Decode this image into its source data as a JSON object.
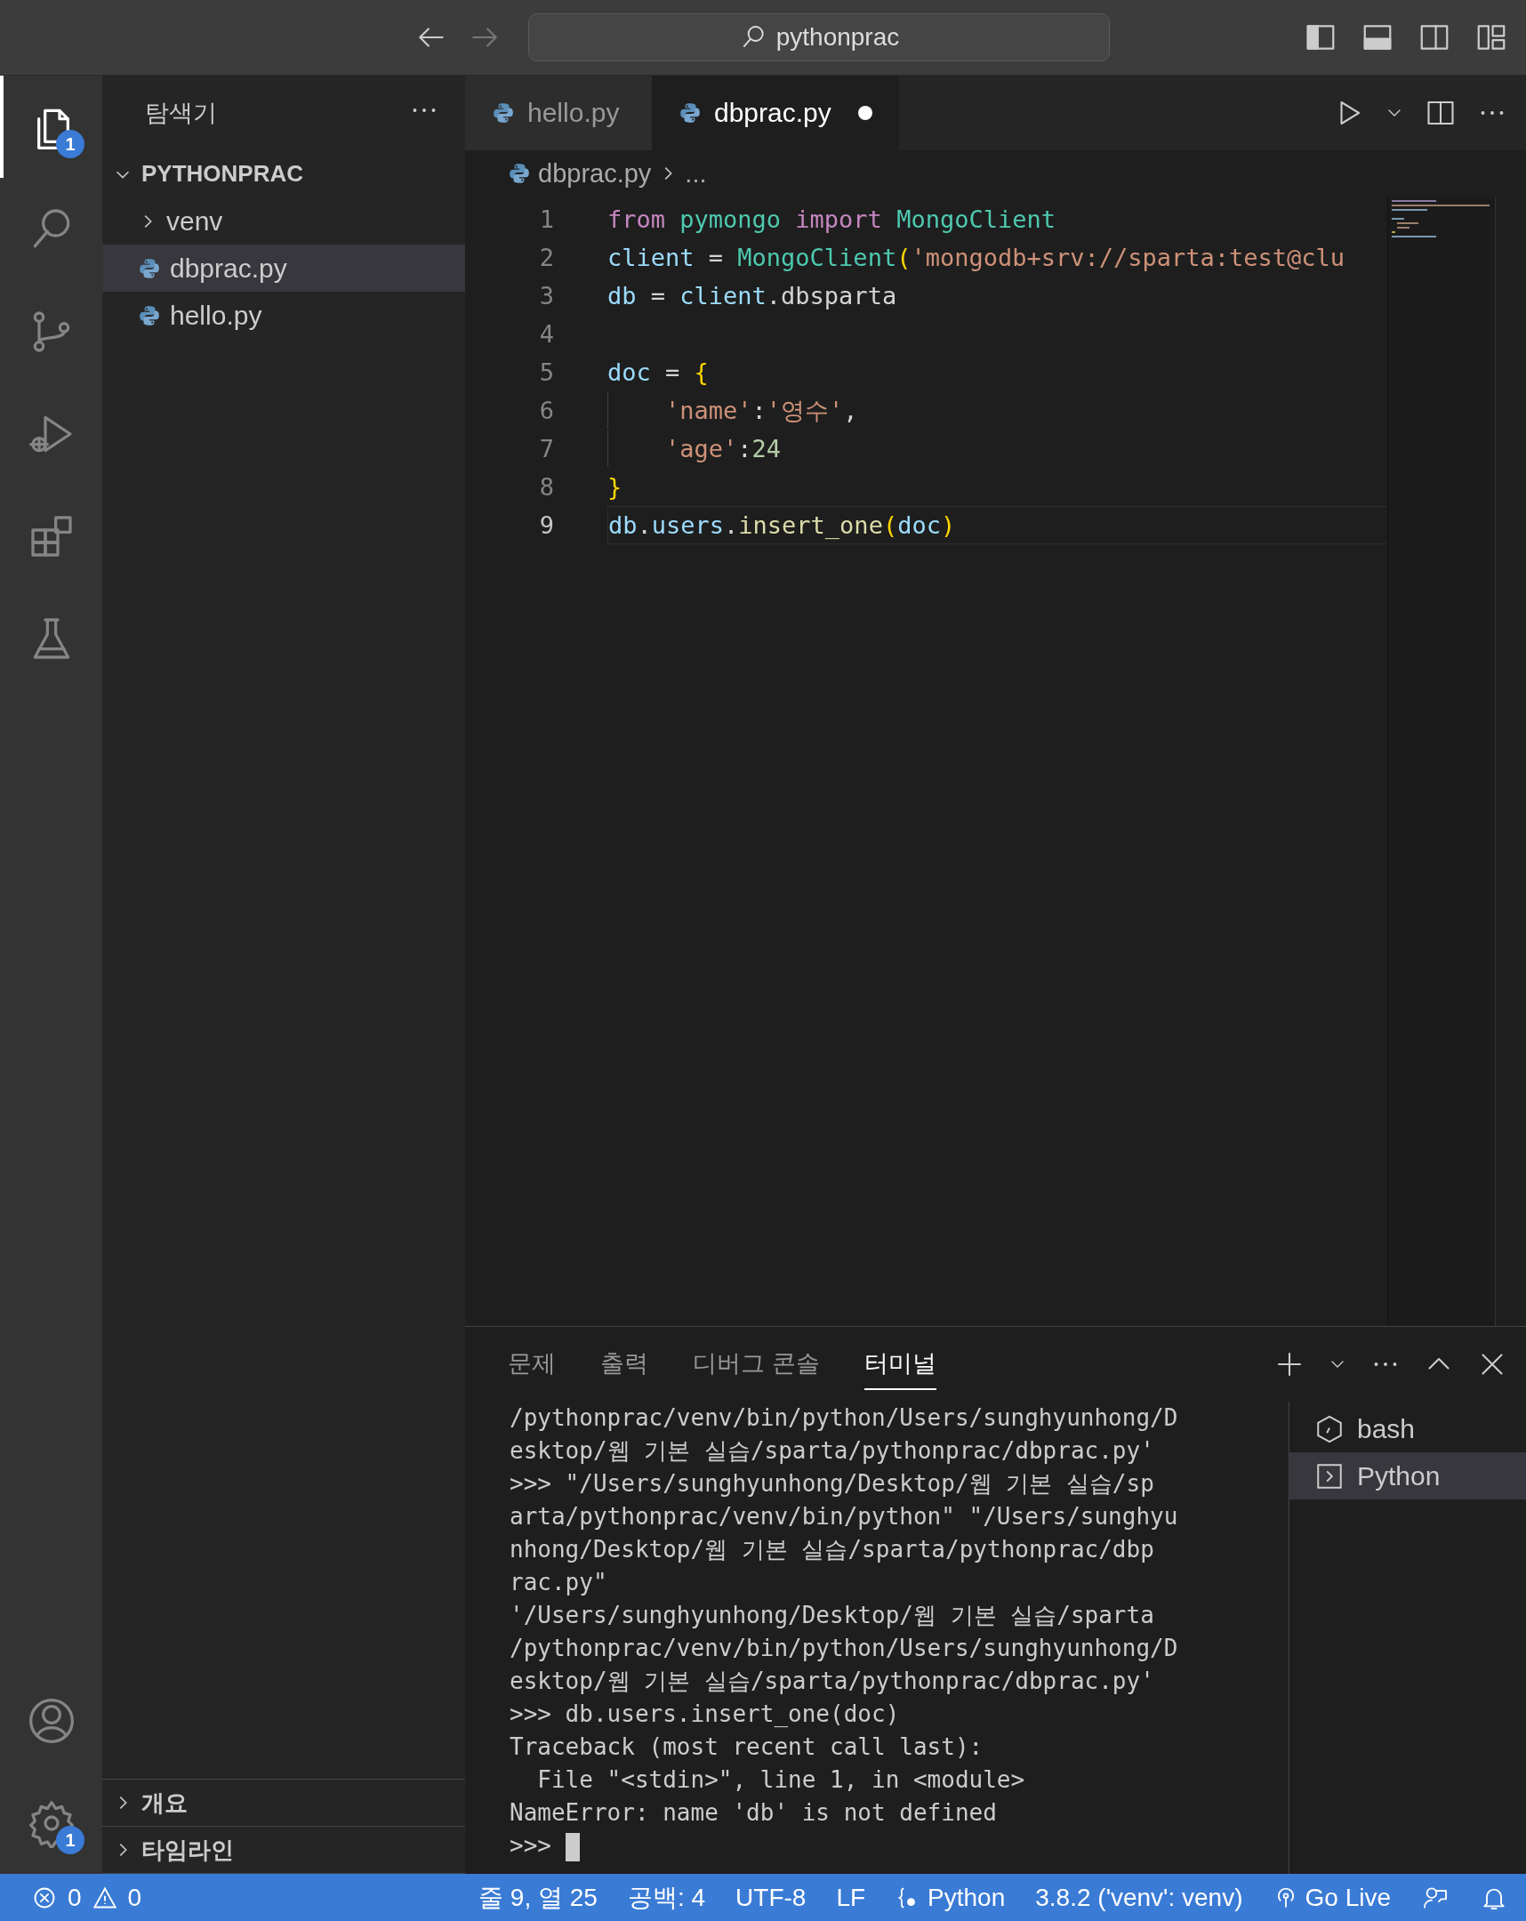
{
  "title_bar": {
    "search": "pythonprac"
  },
  "activity_bar": [
    {
      "kind": "explorer",
      "selected": true,
      "badge": "1"
    },
    {
      "kind": "search",
      "selected": false
    },
    {
      "kind": "source-control",
      "selected": false
    },
    {
      "kind": "run-debug",
      "selected": false
    },
    {
      "kind": "extensions",
      "selected": false
    },
    {
      "kind": "testing",
      "selected": false
    }
  ],
  "activity_bar_bottom": [
    {
      "kind": "account"
    },
    {
      "kind": "settings",
      "badge": "1"
    }
  ],
  "sidebar": {
    "title": "탐색기",
    "folder": {
      "name": "PYTHONPRAC",
      "expanded": true,
      "children": [
        {
          "name": "venv",
          "kind": "folder",
          "expanded": false,
          "selected": false
        },
        {
          "name": "dbprac.py",
          "kind": "python",
          "selected": true
        },
        {
          "name": "hello.py",
          "kind": "python",
          "selected": false
        }
      ]
    },
    "sections": [
      {
        "label": "개요",
        "expanded": false
      },
      {
        "label": "타임라인",
        "expanded": false
      }
    ]
  },
  "tabs": [
    {
      "label": "hello.py",
      "selected": false,
      "modified": false
    },
    {
      "label": "dbprac.py",
      "selected": true,
      "modified": true
    }
  ],
  "breadcrumb": [
    "dbprac.py",
    "..."
  ],
  "editor": {
    "lines": [
      {
        "number": "1",
        "current": false,
        "tokens": [
          {
            "t": "from ",
            "color": "#c586c0"
          },
          {
            "t": "pymongo ",
            "color": "#4ec9b0"
          },
          {
            "t": "import ",
            "color": "#c586c0"
          },
          {
            "t": "MongoClient",
            "color": "#4ec9b0"
          }
        ]
      },
      {
        "number": "2",
        "current": false,
        "tokens": [
          {
            "t": "client",
            "color": "#9cdcfe"
          },
          {
            "t": " = ",
            "color": "#d4d4d4"
          },
          {
            "t": "MongoClient",
            "color": "#4ec9b0"
          },
          {
            "t": "(",
            "color": "#ffd700"
          },
          {
            "t": "'mongodb+srv://sparta:test@clu",
            "color": "#ce9178"
          }
        ]
      },
      {
        "number": "3",
        "current": false,
        "tokens": [
          {
            "t": "db",
            "color": "#9cdcfe"
          },
          {
            "t": " = ",
            "color": "#d4d4d4"
          },
          {
            "t": "client",
            "color": "#9cdcfe"
          },
          {
            "t": ".dbsparta",
            "color": "#d4d4d4"
          }
        ]
      },
      {
        "number": "4",
        "current": false
      },
      {
        "number": "5",
        "current": false,
        "tokens": [
          {
            "t": "doc",
            "color": "#9cdcfe"
          },
          {
            "t": " = ",
            "color": "#d4d4d4"
          },
          {
            "t": "{",
            "color": "#ffd700"
          }
        ]
      },
      {
        "number": "6",
        "current": false,
        "indented": true,
        "tokens": [
          {
            "t": "'name'",
            "color": "#ce9178"
          },
          {
            "t": ":",
            "color": "#d4d4d4"
          },
          {
            "t": "'영수'",
            "color": "#ce9178"
          },
          {
            "t": ",",
            "color": "#d4d4d4"
          }
        ]
      },
      {
        "number": "7",
        "current": false,
        "indented": true,
        "tokens": [
          {
            "t": "'age'",
            "color": "#ce9178"
          },
          {
            "t": ":",
            "color": "#d4d4d4"
          },
          {
            "t": "24",
            "color": "#b5cea8"
          }
        ]
      },
      {
        "number": "8",
        "current": false,
        "tokens": [
          {
            "t": "}",
            "color": "#ffd700"
          }
        ]
      },
      {
        "number": "9",
        "current": true,
        "tokens": [
          {
            "t": "db",
            "color": "#9cdcfe"
          },
          {
            "t": ".",
            "color": "#d4d4d4"
          },
          {
            "t": "users",
            "color": "#9cdcfe"
          },
          {
            "t": ".",
            "color": "#d4d4d4"
          },
          {
            "t": "insert_one",
            "color": "#dcdcaa"
          },
          {
            "t": "(",
            "color": "#ffd700"
          },
          {
            "t": "doc",
            "color": "#9cdcfe"
          },
          {
            "t": ")",
            "color": "#ffd700"
          }
        ]
      }
    ]
  },
  "panel": {
    "tabs": [
      {
        "label": "문제",
        "selected": false
      },
      {
        "label": "출력",
        "selected": false
      },
      {
        "label": "디버그 콘솔",
        "selected": false
      },
      {
        "label": "터미널",
        "selected": true
      }
    ],
    "terminal_lines": [
      "/pythonprac/venv/bin/python/Users/sunghyunhong/D",
      "esktop/웹 기본 실습/sparta/pythonprac/dbprac.py'",
      ">>> \"/Users/sunghyunhong/Desktop/웹 기본 실습/sp",
      "arta/pythonprac/venv/bin/python\" \"/Users/sunghyu",
      "nhong/Desktop/웹 기본 실습/sparta/pythonprac/dbp",
      "rac.py\"",
      "'/Users/sunghyunhong/Desktop/웹 기본 실습/sparta",
      "/pythonprac/venv/bin/python/Users/sunghyunhong/D",
      "esktop/웹 기본 실습/sparta/pythonprac/dbprac.py'",
      ">>> db.users.insert_one(doc)",
      "Traceback (most recent call last):",
      "  File \"<stdin>\", line 1, in <module>",
      "NameError: name 'db' is not defined",
      ">>>"
    ],
    "terminals": [
      {
        "name": "bash",
        "kind": "bash",
        "selected": false
      },
      {
        "name": "Python",
        "kind": "python",
        "selected": true
      }
    ]
  },
  "status_bar": {
    "errors": "0",
    "warnings": "0",
    "items": [
      {
        "kind": "text",
        "label": "줄 9, 열 25"
      },
      {
        "kind": "text",
        "label": "공백: 4"
      },
      {
        "kind": "text",
        "label": "UTF-8"
      },
      {
        "kind": "text",
        "label": "LF"
      },
      {
        "kind": "language",
        "label": "Python"
      },
      {
        "kind": "text",
        "label": "3.8.2 ('venv': venv)"
      },
      {
        "kind": "live",
        "label": "Go Live"
      },
      {
        "kind": "feedback"
      },
      {
        "kind": "bell"
      }
    ]
  }
}
